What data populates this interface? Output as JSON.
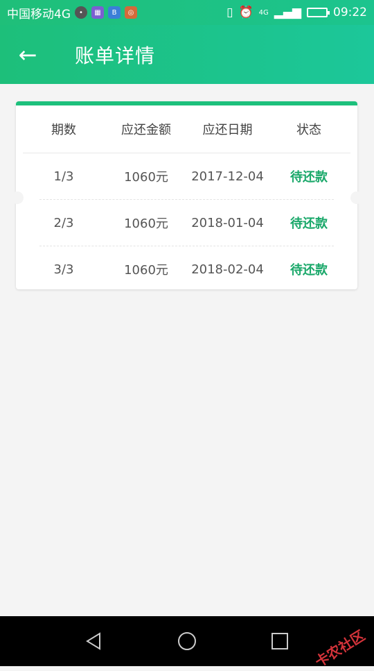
{
  "status_bar": {
    "carrier": "中国移动4G",
    "time": "09:22",
    "network": "4G"
  },
  "header": {
    "title": "账单详情"
  },
  "table": {
    "columns": [
      "期数",
      "应还金额",
      "应还日期",
      "状态"
    ],
    "rows": [
      {
        "period": "1/3",
        "amount": "1060元",
        "date": "2017-12-04",
        "status": "待还款"
      },
      {
        "period": "2/3",
        "amount": "1060元",
        "date": "2018-01-04",
        "status": "待还款"
      },
      {
        "period": "3/3",
        "amount": "1060元",
        "date": "2018-02-04",
        "status": "待还款"
      }
    ]
  },
  "watermark": "卡农社区",
  "colors": {
    "primary": "#1dc07c",
    "status_text": "#1aa86a",
    "background": "#f4f4f4"
  }
}
